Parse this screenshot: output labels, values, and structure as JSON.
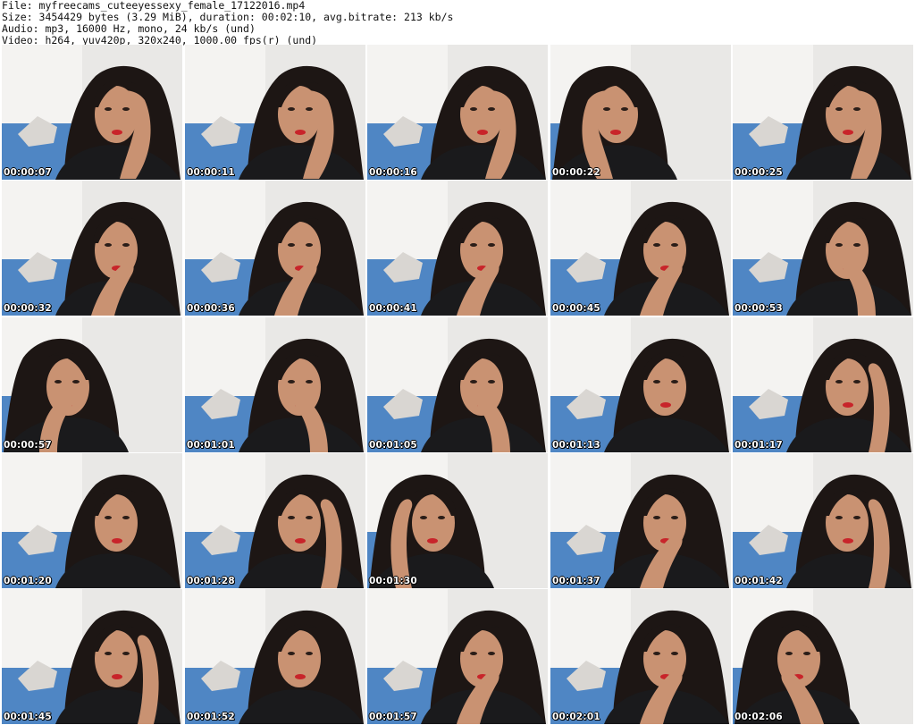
{
  "header": {
    "file_line": "File: myfreecams_cuteeyessexy_female_17122016.mp4",
    "size_line": "Size: 3454429 bytes (3.29 MiB), duration: 00:02:10, avg.bitrate: 213 kb/s",
    "audio_line": "Audio: mp3, 16000 Hz, mono, 24 kb/s (und)",
    "video_line": "Video: h264, yuv420p, 320x240, 1000.00 fps(r) (und)"
  },
  "thumbnails": [
    {
      "timestamp": "00:00:07",
      "pose": "hand-forehead"
    },
    {
      "timestamp": "00:00:11",
      "pose": "hand-forehead"
    },
    {
      "timestamp": "00:00:16",
      "pose": "hand-forehead"
    },
    {
      "timestamp": "00:00:22",
      "pose": "hand-forehead"
    },
    {
      "timestamp": "00:00:25",
      "pose": "hand-forehead"
    },
    {
      "timestamp": "00:00:32",
      "pose": "hand-cheek"
    },
    {
      "timestamp": "00:00:36",
      "pose": "hand-cheek"
    },
    {
      "timestamp": "00:00:41",
      "pose": "hand-cheek"
    },
    {
      "timestamp": "00:00:45",
      "pose": "hand-cheek"
    },
    {
      "timestamp": "00:00:53",
      "pose": "hand-mouth"
    },
    {
      "timestamp": "00:00:57",
      "pose": "hand-mouth"
    },
    {
      "timestamp": "00:01:01",
      "pose": "hand-mouth"
    },
    {
      "timestamp": "00:01:05",
      "pose": "hand-mouth"
    },
    {
      "timestamp": "00:01:13",
      "pose": "neutral"
    },
    {
      "timestamp": "00:01:17",
      "pose": "hand-hair"
    },
    {
      "timestamp": "00:01:20",
      "pose": "neutral"
    },
    {
      "timestamp": "00:01:28",
      "pose": "hand-hair"
    },
    {
      "timestamp": "00:01:30",
      "pose": "hand-hair"
    },
    {
      "timestamp": "00:01:37",
      "pose": "hand-cheek"
    },
    {
      "timestamp": "00:01:42",
      "pose": "hand-hair"
    },
    {
      "timestamp": "00:01:45",
      "pose": "hand-hair"
    },
    {
      "timestamp": "00:01:52",
      "pose": "neutral"
    },
    {
      "timestamp": "00:01:57",
      "pose": "hand-cheek"
    },
    {
      "timestamp": "00:02:01",
      "pose": "hand-cheek"
    },
    {
      "timestamp": "00:02:06",
      "pose": "hand-cheek"
    }
  ],
  "colors": {
    "wall": "#e9e8e6",
    "door": "#f4f3f1",
    "bedding": "#4f86c4",
    "hair": "#1d1614",
    "skin": "#c99272",
    "jacket": "#1a1a1c",
    "lips": "#c8242a"
  }
}
